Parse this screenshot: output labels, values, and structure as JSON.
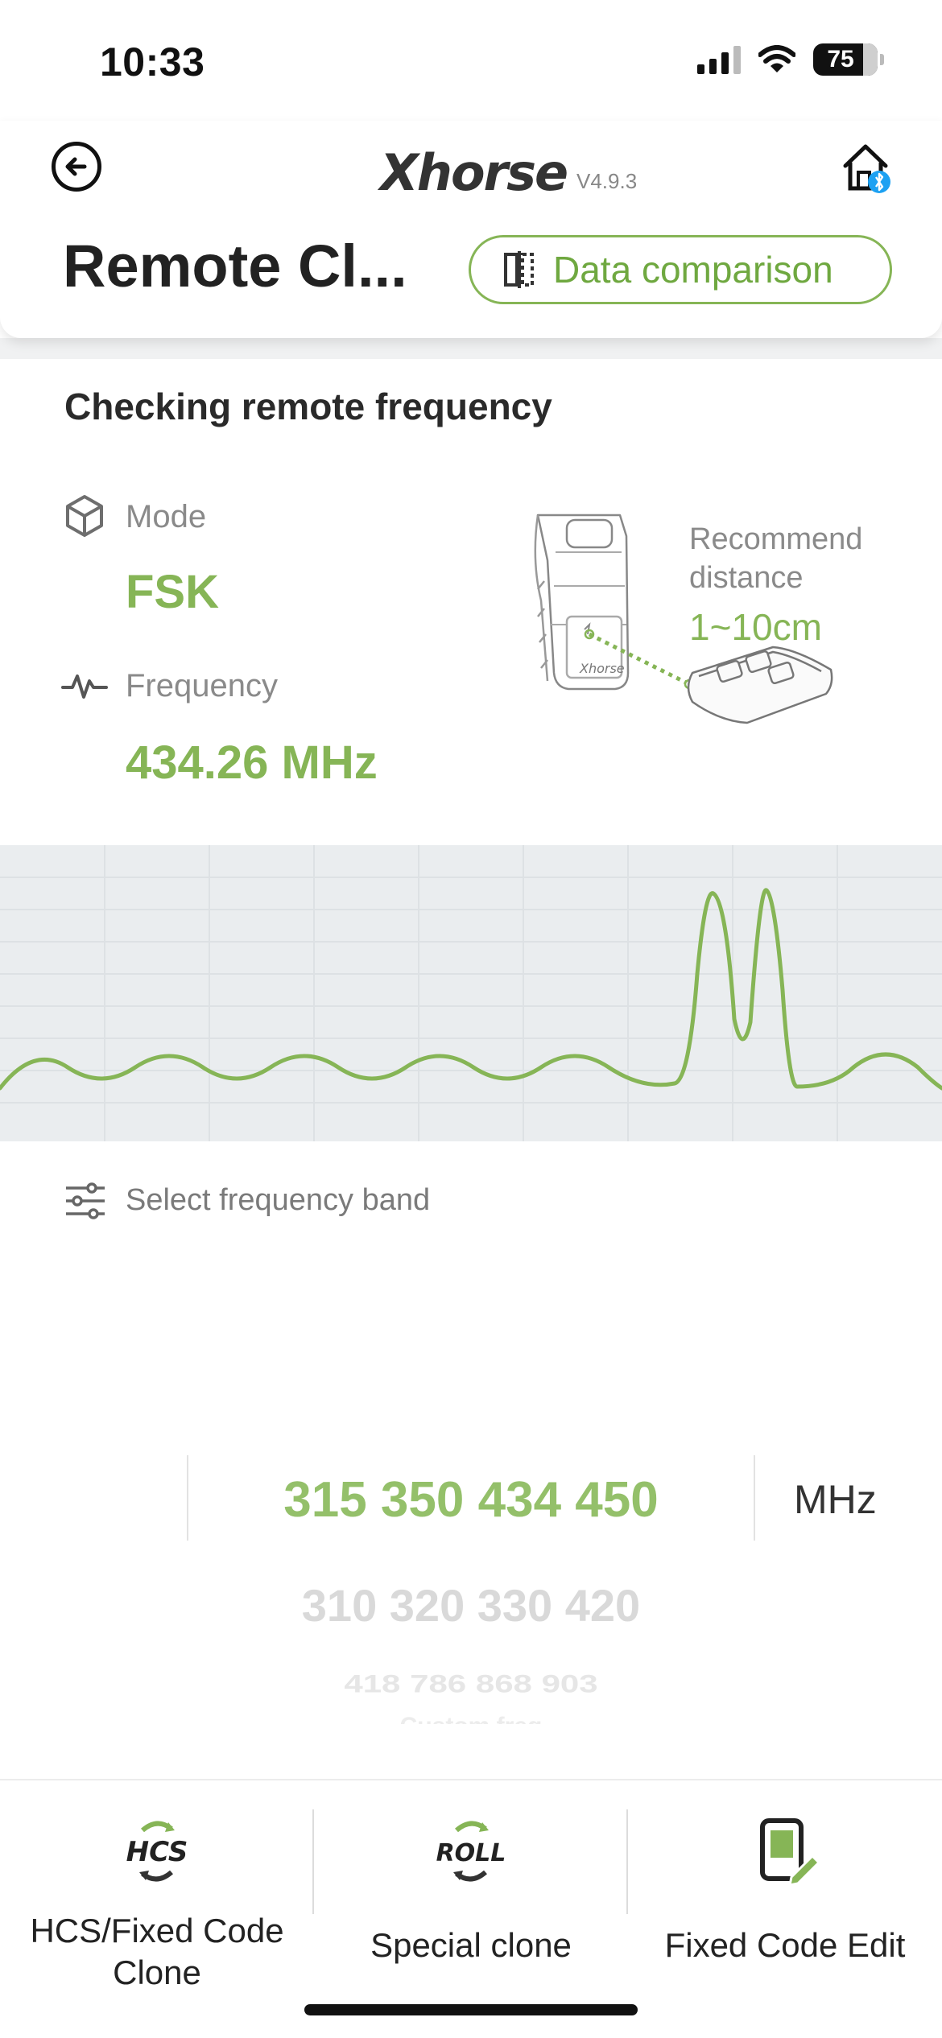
{
  "status_bar": {
    "time": "10:33",
    "battery": "75"
  },
  "header": {
    "logo": "Xhorse",
    "version": "V4.9.3",
    "title": "Remote Cl...",
    "compare_button": "Data comparison",
    "back_icon": "back-arrow-icon",
    "home_icon": "home-bluetooth-icon"
  },
  "main": {
    "section_title": "Checking remote frequency",
    "mode": {
      "label": "Mode",
      "value": "FSK",
      "icon": "cube-icon"
    },
    "frequency": {
      "label": "Frequency",
      "value": "434.26 MHz",
      "icon": "waveform-icon"
    },
    "recommend": {
      "label": "Recommend distance",
      "value": "1~10cm"
    },
    "band_label": "Select frequency band",
    "band_icon": "sliders-icon"
  },
  "picker": {
    "rows": [
      "315 350 434 450",
      "310 320 330 420",
      "418 786 868 903",
      "Custom freq"
    ],
    "unit": "MHz"
  },
  "tabs": [
    {
      "label": "HCS/Fixed Code Clone",
      "icon": "hcs-icon"
    },
    {
      "label": "Special clone",
      "icon": "roll-icon"
    },
    {
      "label": "Fixed Code Edit",
      "icon": "edit-code-icon"
    }
  ],
  "colors": {
    "accent": "#86b556",
    "text": "#222222",
    "muted": "#8a8a8a",
    "wave_bg": "#eaedef"
  }
}
